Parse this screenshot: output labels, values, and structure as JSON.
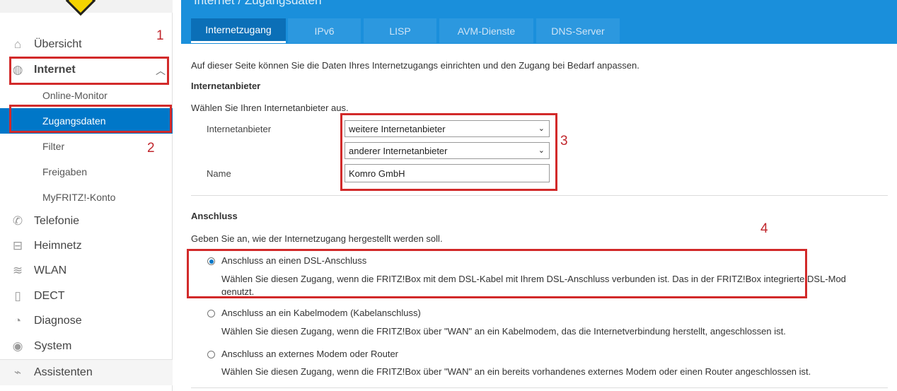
{
  "sidebar": {
    "items": [
      {
        "label": "Übersicht",
        "icon": "home-icon"
      },
      {
        "label": "Internet",
        "icon": "globe-icon"
      },
      {
        "label": "Telefonie",
        "icon": "phone-icon"
      },
      {
        "label": "Heimnetz",
        "icon": "network-icon"
      },
      {
        "label": "WLAN",
        "icon": "wifi-icon"
      },
      {
        "label": "DECT",
        "icon": "dect-icon"
      },
      {
        "label": "Diagnose",
        "icon": "diagnose-icon"
      },
      {
        "label": "System",
        "icon": "system-icon"
      },
      {
        "label": "Assistenten",
        "icon": "wizard-icon"
      }
    ],
    "internet_sub": [
      "Online-Monitor",
      "Zugangsdaten",
      "Filter",
      "Freigaben",
      "MyFRITZ!-Konto"
    ]
  },
  "header": {
    "page_title": "Internet / Zugangsdaten",
    "tabs": [
      "Internetzugang",
      "IPv6",
      "LISP",
      "AVM-Dienste",
      "DNS-Server"
    ]
  },
  "main": {
    "intro": "Auf dieser Seite können Sie die Daten Ihres Internetzugangs einrichten und den Zugang bei Bedarf anpassen.",
    "provider_heading": "Internetanbieter",
    "provider_hint": "Wählen Sie Ihren Internetanbieter aus.",
    "provider_label": "Internetanbieter",
    "provider_select_1": "weitere Internetanbieter",
    "provider_select_2": "anderer Internetanbieter",
    "name_label": "Name",
    "name_value": "Komro GmbH",
    "connection_heading": "Anschluss",
    "connection_hint": "Geben Sie an, wie der Internetzugang hergestellt werden soll.",
    "options": [
      {
        "label": "Anschluss an einen DSL-Anschluss",
        "desc": "Wählen Sie diesen Zugang, wenn die FRITZ!Box mit dem DSL-Kabel mit Ihrem DSL-Anschluss verbunden ist. Das in der FRITZ!Box integrierte DSL-Mod",
        "desc2": "genutzt.",
        "checked": true
      },
      {
        "label": "Anschluss an ein Kabelmodem (Kabelanschluss)",
        "desc": "Wählen Sie diesen Zugang, wenn die FRITZ!Box über \"WAN\" an ein Kabelmodem, das die Internetverbindung herstellt, angeschlossen ist.",
        "checked": false
      },
      {
        "label": "Anschluss an externes Modem oder Router",
        "desc": "Wählen Sie diesen Zugang, wenn die FRITZ!Box über \"WAN\" an ein bereits vorhandenes externes Modem oder einen Router angeschlossen ist.",
        "checked": false
      }
    ]
  },
  "annotations": [
    "1",
    "2",
    "3",
    "4"
  ],
  "colors": {
    "accent": "#0077c8",
    "topbar": "#1a8fdb",
    "annotation": "#d22a2a"
  }
}
